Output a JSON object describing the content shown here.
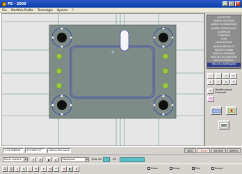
{
  "window": {
    "title": "PS - 2000",
    "controls": [
      "_",
      "□",
      "×"
    ]
  },
  "menu": [
    "File",
    "Modifica Profilo",
    "Tecnologia",
    "Opzioni",
    "?"
  ],
  "palette": {
    "items": [
      "ALESATORE",
      "BAREN. DESTORE",
      "BAREN. DOMINAZIONE",
      "BAREN. INTERPOLATA",
      "CLAPPAGGI",
      "FORATURE",
      "FORI",
      "MASCHIATURE",
      "MASCHI METALLICI",
      "MASCHI LUMINA",
      "MASCHI LUMINARIE",
      "MASCHI LAVORAZIONE",
      "MASCHI CENTRALI",
      "MASCHI LAMPADARIE"
    ],
    "selected_index": 13
  },
  "side_tools": {
    "grid": [
      "⟋",
      "⟍",
      "▱",
      "▭",
      "↙",
      "✂",
      "⊙",
      "⌖"
    ],
    "pen_label": "Modificazione Elementi",
    "extra_icon": "✎"
  },
  "coord": {
    "x_value": "-170.758008",
    "y_value": "170.067717",
    "mode": "Ultimo Elemento",
    "tabs": [
      "INFO",
      "TECNO",
      "SISTEMI",
      "SEMPLI"
    ],
    "active_tab": 1
  },
  "options": {
    "layer_combo": "Primo Livello 1",
    "style_combo": "Massimale",
    "label_a": "Stile 3D",
    "label_b": "ZO"
  },
  "status": {
    "icons": [
      "Q",
      "Q",
      "⌕",
      "⊙",
      "⬡",
      "✎",
      "✔",
      "⟲",
      "↶",
      "⊕",
      "◧",
      "✕"
    ],
    "checkboxes": [
      {
        "label": "Zoom",
        "checked": true
      },
      {
        "label": "Snap",
        "checked": true
      },
      {
        "label": "Prof",
        "checked": true
      },
      {
        "label": "Bande",
        "checked": true
      }
    ]
  },
  "colors": {
    "plate": "#7e8c88",
    "outline": "#2a34b8",
    "grid_line": "#5a9080",
    "hole_light": "#9ccc3c",
    "palette_bg": "#8e8e8e",
    "titlebar": "#0a3ea8"
  }
}
